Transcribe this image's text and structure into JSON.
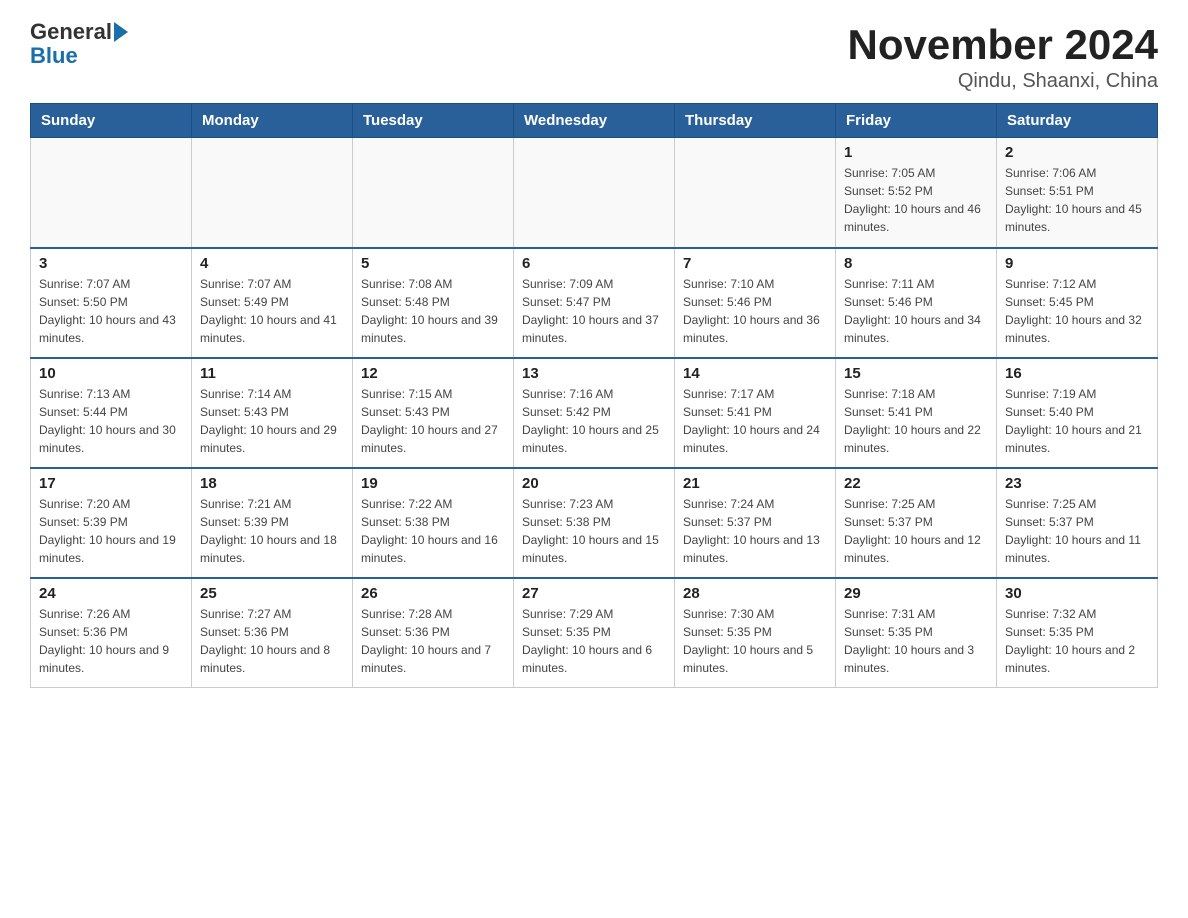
{
  "header": {
    "logo_general": "General",
    "logo_blue": "Blue",
    "title": "November 2024",
    "subtitle": "Qindu, Shaanxi, China"
  },
  "weekdays": [
    "Sunday",
    "Monday",
    "Tuesday",
    "Wednesday",
    "Thursday",
    "Friday",
    "Saturday"
  ],
  "weeks": [
    [
      {
        "day": "",
        "info": ""
      },
      {
        "day": "",
        "info": ""
      },
      {
        "day": "",
        "info": ""
      },
      {
        "day": "",
        "info": ""
      },
      {
        "day": "",
        "info": ""
      },
      {
        "day": "1",
        "info": "Sunrise: 7:05 AM\nSunset: 5:52 PM\nDaylight: 10 hours and 46 minutes."
      },
      {
        "day": "2",
        "info": "Sunrise: 7:06 AM\nSunset: 5:51 PM\nDaylight: 10 hours and 45 minutes."
      }
    ],
    [
      {
        "day": "3",
        "info": "Sunrise: 7:07 AM\nSunset: 5:50 PM\nDaylight: 10 hours and 43 minutes."
      },
      {
        "day": "4",
        "info": "Sunrise: 7:07 AM\nSunset: 5:49 PM\nDaylight: 10 hours and 41 minutes."
      },
      {
        "day": "5",
        "info": "Sunrise: 7:08 AM\nSunset: 5:48 PM\nDaylight: 10 hours and 39 minutes."
      },
      {
        "day": "6",
        "info": "Sunrise: 7:09 AM\nSunset: 5:47 PM\nDaylight: 10 hours and 37 minutes."
      },
      {
        "day": "7",
        "info": "Sunrise: 7:10 AM\nSunset: 5:46 PM\nDaylight: 10 hours and 36 minutes."
      },
      {
        "day": "8",
        "info": "Sunrise: 7:11 AM\nSunset: 5:46 PM\nDaylight: 10 hours and 34 minutes."
      },
      {
        "day": "9",
        "info": "Sunrise: 7:12 AM\nSunset: 5:45 PM\nDaylight: 10 hours and 32 minutes."
      }
    ],
    [
      {
        "day": "10",
        "info": "Sunrise: 7:13 AM\nSunset: 5:44 PM\nDaylight: 10 hours and 30 minutes."
      },
      {
        "day": "11",
        "info": "Sunrise: 7:14 AM\nSunset: 5:43 PM\nDaylight: 10 hours and 29 minutes."
      },
      {
        "day": "12",
        "info": "Sunrise: 7:15 AM\nSunset: 5:43 PM\nDaylight: 10 hours and 27 minutes."
      },
      {
        "day": "13",
        "info": "Sunrise: 7:16 AM\nSunset: 5:42 PM\nDaylight: 10 hours and 25 minutes."
      },
      {
        "day": "14",
        "info": "Sunrise: 7:17 AM\nSunset: 5:41 PM\nDaylight: 10 hours and 24 minutes."
      },
      {
        "day": "15",
        "info": "Sunrise: 7:18 AM\nSunset: 5:41 PM\nDaylight: 10 hours and 22 minutes."
      },
      {
        "day": "16",
        "info": "Sunrise: 7:19 AM\nSunset: 5:40 PM\nDaylight: 10 hours and 21 minutes."
      }
    ],
    [
      {
        "day": "17",
        "info": "Sunrise: 7:20 AM\nSunset: 5:39 PM\nDaylight: 10 hours and 19 minutes."
      },
      {
        "day": "18",
        "info": "Sunrise: 7:21 AM\nSunset: 5:39 PM\nDaylight: 10 hours and 18 minutes."
      },
      {
        "day": "19",
        "info": "Sunrise: 7:22 AM\nSunset: 5:38 PM\nDaylight: 10 hours and 16 minutes."
      },
      {
        "day": "20",
        "info": "Sunrise: 7:23 AM\nSunset: 5:38 PM\nDaylight: 10 hours and 15 minutes."
      },
      {
        "day": "21",
        "info": "Sunrise: 7:24 AM\nSunset: 5:37 PM\nDaylight: 10 hours and 13 minutes."
      },
      {
        "day": "22",
        "info": "Sunrise: 7:25 AM\nSunset: 5:37 PM\nDaylight: 10 hours and 12 minutes."
      },
      {
        "day": "23",
        "info": "Sunrise: 7:25 AM\nSunset: 5:37 PM\nDaylight: 10 hours and 11 minutes."
      }
    ],
    [
      {
        "day": "24",
        "info": "Sunrise: 7:26 AM\nSunset: 5:36 PM\nDaylight: 10 hours and 9 minutes."
      },
      {
        "day": "25",
        "info": "Sunrise: 7:27 AM\nSunset: 5:36 PM\nDaylight: 10 hours and 8 minutes."
      },
      {
        "day": "26",
        "info": "Sunrise: 7:28 AM\nSunset: 5:36 PM\nDaylight: 10 hours and 7 minutes."
      },
      {
        "day": "27",
        "info": "Sunrise: 7:29 AM\nSunset: 5:35 PM\nDaylight: 10 hours and 6 minutes."
      },
      {
        "day": "28",
        "info": "Sunrise: 7:30 AM\nSunset: 5:35 PM\nDaylight: 10 hours and 5 minutes."
      },
      {
        "day": "29",
        "info": "Sunrise: 7:31 AM\nSunset: 5:35 PM\nDaylight: 10 hours and 3 minutes."
      },
      {
        "day": "30",
        "info": "Sunrise: 7:32 AM\nSunset: 5:35 PM\nDaylight: 10 hours and 2 minutes."
      }
    ]
  ]
}
